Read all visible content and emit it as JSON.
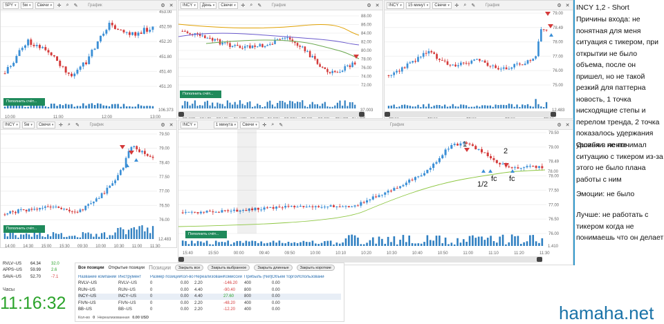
{
  "panels": {
    "p1": {
      "ticker": "SPY",
      "timeframe": "5м",
      "style": "Свечи",
      "graph": "График",
      "yticks": [
        "453.00",
        "452.59",
        "452.20",
        "451.80",
        "451.40",
        "451.20"
      ],
      "last": "452.59",
      "xticks": [
        "10:00",
        "11:00",
        "12:00",
        "13:00"
      ],
      "volume": "106.373",
      "populate": "Пополнить счёт..."
    },
    "p2": {
      "ticker": "INCY",
      "timeframe": "День",
      "style": "Свечи",
      "graph": "График",
      "yticks": [
        "88.00",
        "86.00",
        "84.00",
        "82.00",
        "80.00",
        "78.00",
        "76.00",
        "74.00",
        "72.00"
      ],
      "last": "78.68",
      "xticks": [
        "23 Mar",
        "08 Apr",
        "23 Apr",
        "10 May",
        "25 May",
        "10 Jun",
        "25 Jun",
        "12 Jul",
        "28 Jul",
        "12 Aug",
        "27 Aug"
      ],
      "volume": "37.003",
      "populate": "Пополнить счёт..."
    },
    "p3": {
      "ticker": "INCY",
      "timeframe": "15 минут",
      "style": "Свечи",
      "graph": "График",
      "yticks": [
        "79.00",
        "78.49",
        "78.00",
        "77.00",
        "76.00",
        "75.00"
      ],
      "last": "78.49",
      "xticks": [
        "12:00",
        "15:00",
        "12:00",
        "15:00",
        "12:00"
      ],
      "volume": "12.483"
    },
    "p4": {
      "ticker": "INCY",
      "timeframe": "5м",
      "style": "Свечи",
      "graph": "График",
      "yticks": [
        "79.50",
        "79.00",
        "78.40",
        "77.50",
        "77.00",
        "76.50",
        "76.00"
      ],
      "last": "78.40",
      "xticks": [
        "14:00",
        "14:30",
        "15:00",
        "15:30",
        "09:30",
        "10:00",
        "10:30",
        "11:00",
        "11:30"
      ],
      "volume": "12.483",
      "populate": "Пополнить счёт..."
    },
    "p5": {
      "ticker": "INCY",
      "timeframe": "1 минута",
      "style": "Свечи",
      "graph": "График",
      "yticks": [
        "79.50",
        "79.00",
        "78.49",
        "78.00",
        "77.50",
        "77.00",
        "76.50",
        "76.00"
      ],
      "last": "78.49",
      "level": "78.00",
      "xticks": [
        "15:40",
        "15:50",
        "00:00",
        "09:40",
        "09:50",
        "10:00",
        "10:10",
        "10:20",
        "10:30",
        "10:40",
        "10:50",
        "11:00",
        "11:10",
        "11:20",
        "11:30"
      ],
      "volume": "1.410",
      "populate": "Пополнить счёт...",
      "annotations": {
        "a1": "1",
        "a2": "2",
        "a3": "1/2",
        "a4": "fc",
        "a5": "fc"
      }
    }
  },
  "notes": {
    "title": "INCY 1,2 - Short",
    "reason": "Причины входа: не понятная для меня ситуация с тикером, при открытии не было объема, после он пришел, но не такой резкий для паттерна новость, 1 точка нисходящие степы и перелом тренда, 2 точка показалось удержания уровня в ленте",
    "errors": "Ошибки: не понимал ситуацию с тикером из-за этого не было плана работы с ним",
    "emotions": "Эмоции: не было",
    "better": "Лучше: не работать с тикером когда не понимаешь что он делает"
  },
  "watchlist": {
    "rows": [
      {
        "sym": "RVLV~US",
        "price": "64.34",
        "chg": "32.0"
      },
      {
        "sym": "APPS~US",
        "price": "59.99",
        "chg": "2.6"
      },
      {
        "sym": "SAVA~US",
        "price": "52.70",
        "chg": "-7.1"
      }
    ]
  },
  "clock": {
    "title": "Часы",
    "time": "11:16:32"
  },
  "positions": {
    "tab_all": "Все позиции",
    "tab_open": "Открытые позиции",
    "title": "Позиции",
    "buttons": [
      "Закрыть все",
      "Закрыть выбранное",
      "Закрыть длинные",
      "Закрыть короткие"
    ],
    "headers": [
      "Название компании",
      "Инструмент",
      "Размер позиции",
      "Кол-во",
      "Нереализованная",
      "Комиссии",
      "Прибыль (Net)",
      "Объем торгов",
      "Использование"
    ],
    "rows": [
      [
        "RVLV~US",
        "RVLV~US",
        "0",
        "0.00",
        "2.20",
        "-146.20",
        "400",
        "0.00"
      ],
      [
        "RUN~US",
        "RUN~US",
        "0",
        "0.00",
        "4.40",
        "-90.40",
        "800",
        "0.00"
      ],
      [
        "INCY~US",
        "INCY~US",
        "0",
        "0.00",
        "4.40",
        "27.60",
        "800",
        "0.00"
      ],
      [
        "FIVN~US",
        "FIVN~US",
        "0",
        "0.00",
        "2.20",
        "-48.20",
        "400",
        "0.00"
      ],
      [
        "BB~US",
        "BB~US",
        "0",
        "0.00",
        "2.20",
        "-12.20",
        "400",
        "0.00"
      ]
    ],
    "footer_qty": "Кол-во",
    "footer_qty_val": "0",
    "footer_unreal": "Нереализованная",
    "footer_unreal_val": "0.00 USD"
  },
  "brand": "hamaha.net",
  "colors": {
    "up": "#3b8fd6",
    "down": "#d43a3a",
    "level": "#8cc63f",
    "populate": "#1f8a5b",
    "clock": "#2aa32a"
  }
}
